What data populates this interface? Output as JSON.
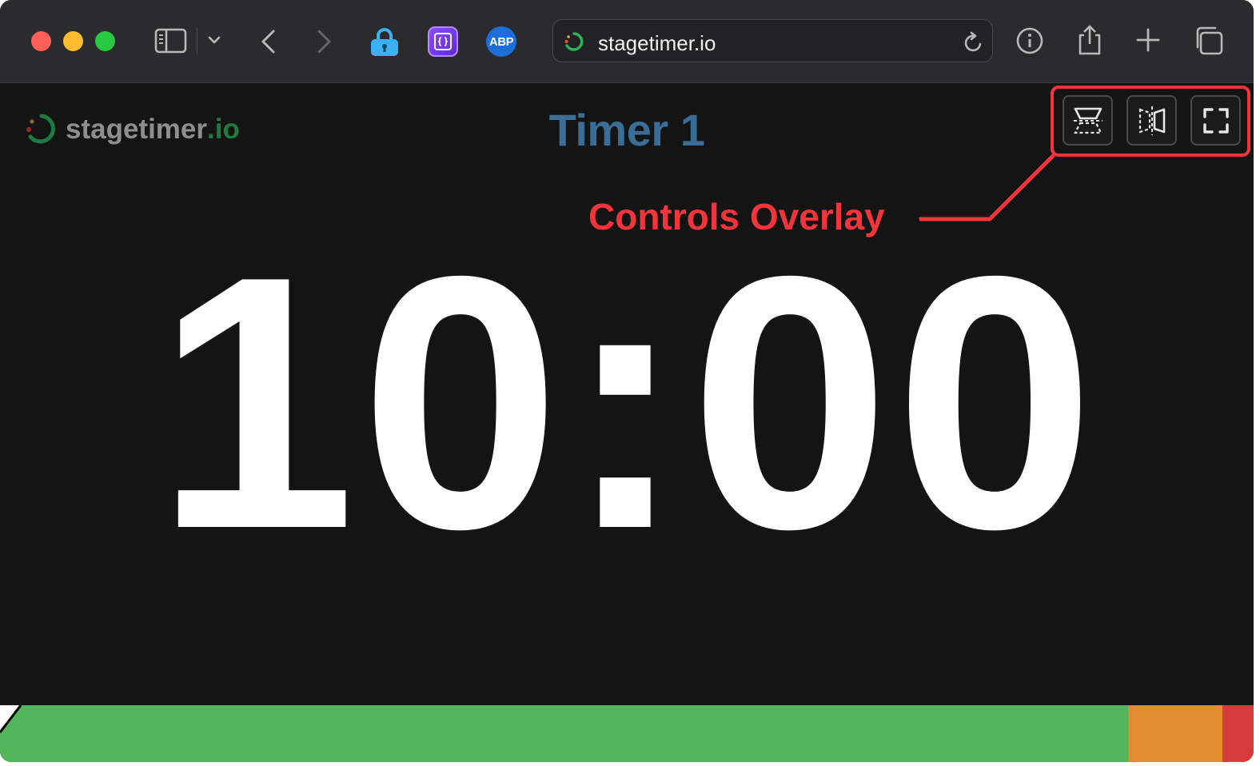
{
  "browser": {
    "url": "stagetimer.io",
    "extensions": {
      "abp_label": "ABP"
    }
  },
  "page": {
    "brand_main": "stagetimer",
    "brand_tld": ".io",
    "timer_title": "Timer 1",
    "time_display": "10:00",
    "annotation": "Controls Overlay",
    "controls": [
      "flip-view",
      "mirror-view",
      "fullscreen"
    ]
  },
  "progress": {
    "segments": [
      {
        "name": "green",
        "color": "#51b75a"
      },
      {
        "name": "warning",
        "color": "#e28c30"
      },
      {
        "name": "danger",
        "color": "#d73c3c"
      }
    ]
  },
  "colors": {
    "annotation": "#f3343a",
    "title": "#3a6e98",
    "brand_accent": "#1f7b3d"
  }
}
